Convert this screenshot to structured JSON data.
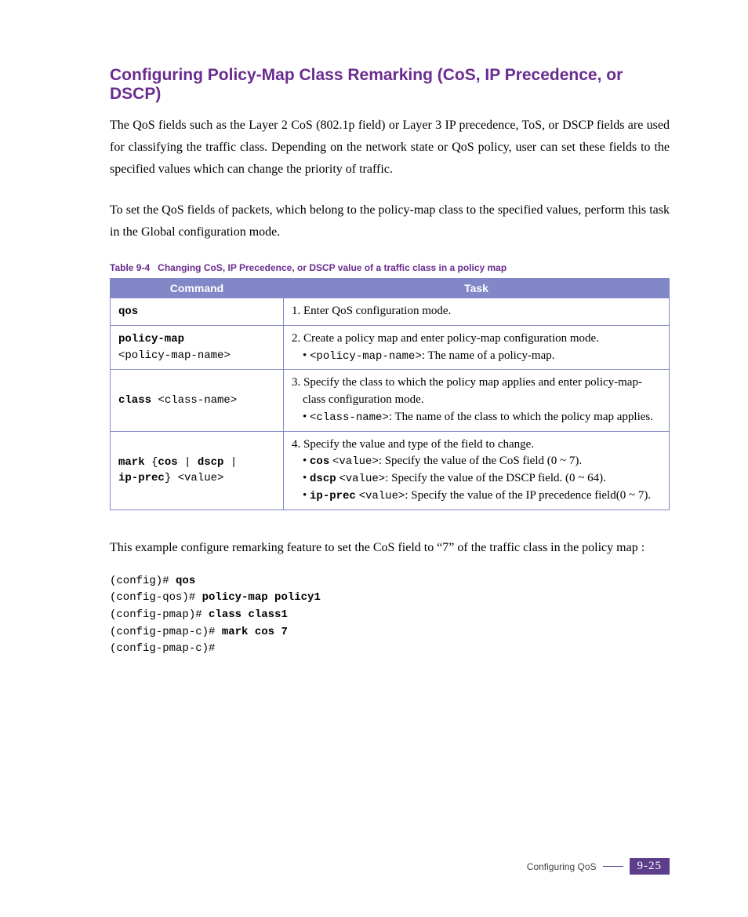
{
  "heading": "Configuring Policy-Map Class Remarking (CoS, IP Precedence, or DSCP)",
  "para1": "The QoS fields such as the Layer 2 CoS (802.1p field) or Layer 3 IP precedence, ToS, or DSCP fields are used for classifying the traffic class. Depending on the network state or QoS policy, user can set these fields to the specified values which can change the priority of traffic.",
  "para2": "To set the QoS fields of packets, which belong to the policy-map class to the specified values, perform this task in the Global configuration mode.",
  "table": {
    "caption_prefix": "Table 9-4",
    "caption_text": "Changing CoS, IP Precedence, or DSCP value of a traffic class in a policy map",
    "headers": {
      "col1": "Command",
      "col2": "Task"
    },
    "rows": [
      {
        "cmd_html": "qos",
        "task_html": "1.  Enter QoS configuration mode."
      },
      {
        "cmd_html": "policy-map<br><span style=\"font-weight:normal\">&lt;policy-map-name&gt;</span>",
        "task_html": "2. Create a policy map and enter policy-map configuration mode.<br><span class=\"indent\">• <span class=\"mono\">&lt;policy-map-name&gt;</span>: The name of a policy-map.</span>"
      },
      {
        "cmd_html": "class <span style=\"font-weight:normal\">&lt;class-name&gt;</span>",
        "task_html": "3. Specify the class to which the policy map applies and enter policy-map-<br><span class=\"indent\">class configuration mode.</span><span class=\"indent\">• <span class=\"mono\">&lt;class-name&gt;</span>: The name of the class to which the policy map applies.</span>"
      },
      {
        "cmd_html": "mark <span style=\"font-weight:normal\">{</span>cos <span style=\"font-weight:normal\">|</span> dscp <span style=\"font-weight:normal\">|</span><br>ip-prec<span style=\"font-weight:normal\">} &lt;value&gt;</span>",
        "task_html": "4. Specify the value and type of the field to change.<br><span class=\"indent\">• <span class=\"mono-b\">cos</span> <span class=\"mono\">&lt;value&gt;</span>: Specify the value of the CoS field (0 ~ 7).</span><span class=\"indent\">• <span class=\"mono-b\">dscp</span> <span class=\"mono\">&lt;value&gt;</span>: Specify the value of the DSCP field. (0 ~ 64).</span><span class=\"indent\">• <span class=\"mono-b\">ip-prec</span> <span class=\"mono\">&lt;value&gt;</span>: Specify the value of the IP precedence field(0 ~ 7).</span>"
      }
    ]
  },
  "example_text_1": "This example configure remarking feature to set the CoS field to “7” of the traffic class",
  "example_text_2": "in the policy map",
  "example_gap1": "            ",
  "example_gap2": "           ",
  "example_colon": ":",
  "cli_lines": [
    {
      "prompt": "(config)# ",
      "cmd": "qos"
    },
    {
      "prompt": "(config-qos)# ",
      "cmd": "policy-map policy1"
    },
    {
      "prompt": "(config-pmap)# ",
      "cmd": "class class1"
    },
    {
      "prompt": "(config-pmap-c)# ",
      "cmd": "mark cos 7"
    },
    {
      "prompt": "(config-pmap-c)#",
      "cmd": ""
    }
  ],
  "footer": {
    "label": "Configuring QoS",
    "page": "9-25"
  }
}
